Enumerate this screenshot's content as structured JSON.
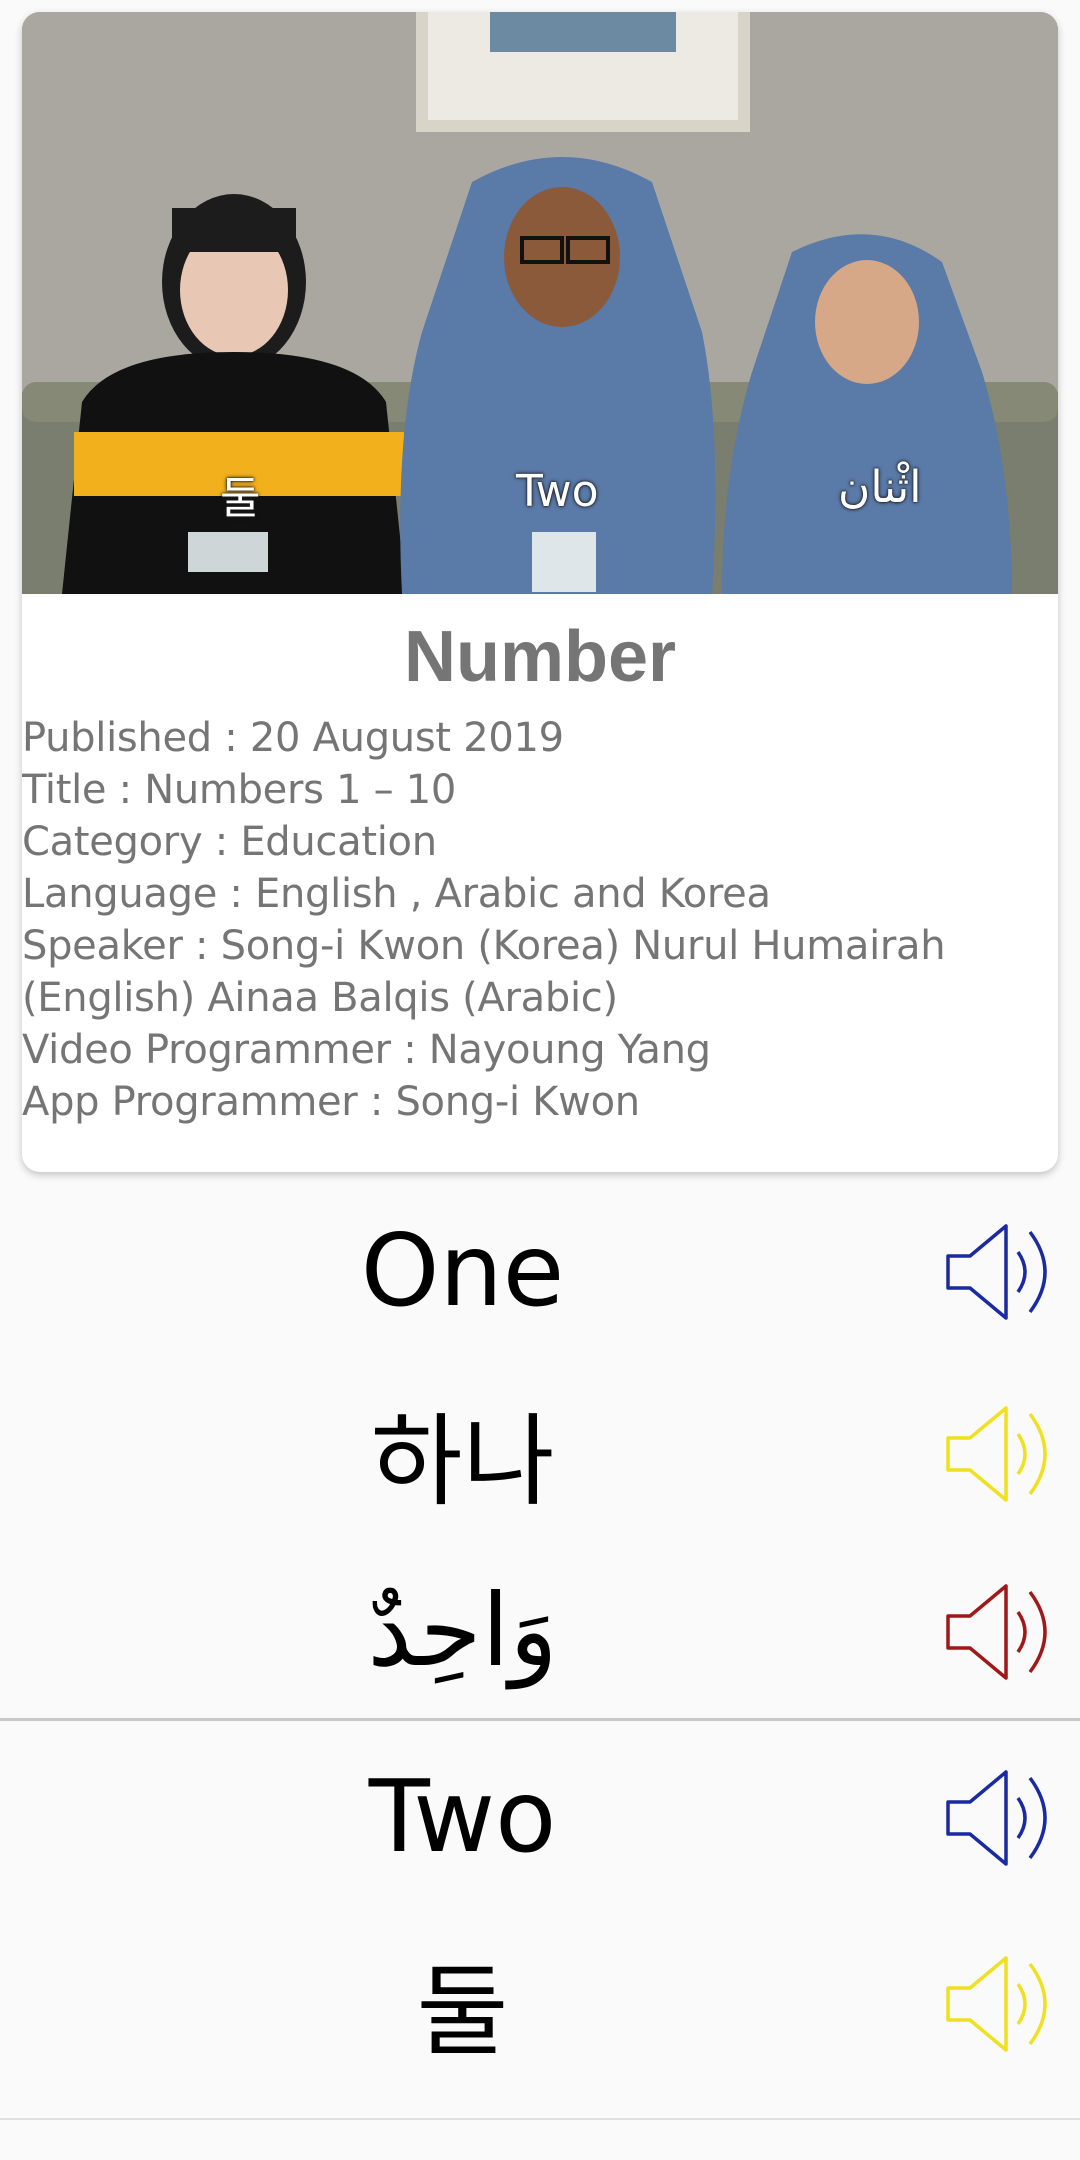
{
  "video": {
    "subtitles": {
      "korean": "둘",
      "english": "Two",
      "arabic": "اثْنان"
    }
  },
  "card": {
    "title": "Number",
    "info": {
      "published": "Published : 20 August 2019",
      "title": " Title : Numbers 1 – 10",
      "category": " Category : Education",
      "language": " Language : English , Arabic and Korea",
      "speaker_line1": " Speaker : Song-i Kwon (Korea) Nurul Humairah",
      "speaker_line2": "(English) Ainaa Balqis (Arabic)",
      "video_programmer": " Video Programmer : Nayoung Yang",
      "app_programmer": " App Programmer : Song-i Kwon"
    }
  },
  "words": [
    {
      "text": "One",
      "lang": "english",
      "speaker_color": "#1a2aa0",
      "icon": "speaker-icon"
    },
    {
      "text": "하나",
      "lang": "korean",
      "speaker_color": "#f0e020",
      "icon": "speaker-icon"
    },
    {
      "text": "وَاحِدٌ",
      "lang": "arabic",
      "speaker_color": "#a01818",
      "icon": "speaker-icon"
    },
    {
      "text": "Two",
      "lang": "english",
      "speaker_color": "#1a2aa0",
      "icon": "speaker-icon"
    },
    {
      "text": "둘",
      "lang": "korean",
      "speaker_color": "#f0e020",
      "icon": "speaker-icon"
    }
  ]
}
